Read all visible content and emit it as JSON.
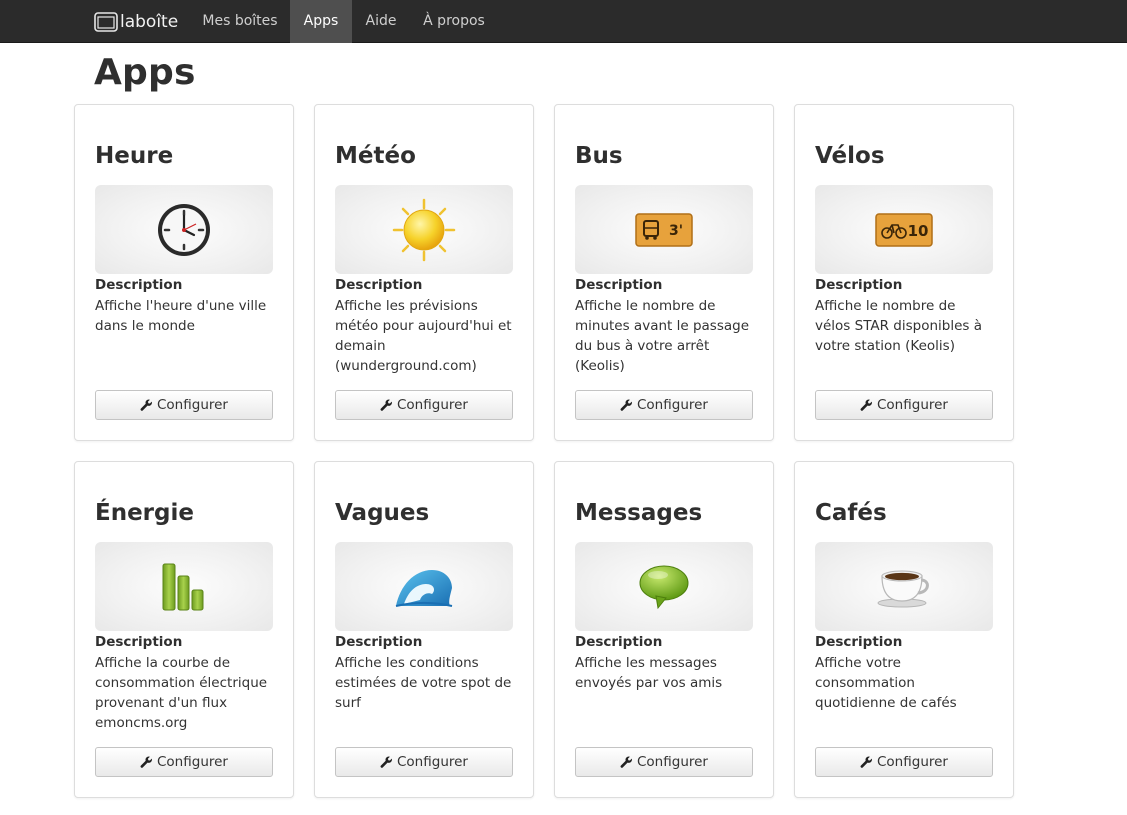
{
  "navbar": {
    "brand": "laboîte",
    "items": [
      {
        "label": "Mes boîtes"
      },
      {
        "label": "Apps"
      },
      {
        "label": "Aide"
      },
      {
        "label": "À propos"
      }
    ]
  },
  "page": {
    "title": "Apps"
  },
  "apps": [
    {
      "title": "Heure",
      "icon": "clock-icon",
      "desc_label": "Description",
      "description": "Affiche l'heure d'une ville dans le monde",
      "button": "Configurer"
    },
    {
      "title": "Météo",
      "icon": "sun-icon",
      "desc_label": "Description",
      "description": "Affiche les prévisions météo pour aujourd'hui et demain (wunderground.com)",
      "button": "Configurer"
    },
    {
      "title": "Bus",
      "icon": "bus-icon",
      "icon_text": "3'",
      "desc_label": "Description",
      "description": "Affiche le nombre de minutes avant le passage du bus à votre arrêt (Keolis)",
      "button": "Configurer"
    },
    {
      "title": "Vélos",
      "icon": "bike-icon",
      "icon_text": "10",
      "desc_label": "Description",
      "description": "Affiche le nombre de vélos STAR disponibles à votre station (Keolis)",
      "button": "Configurer"
    },
    {
      "title": "Énergie",
      "icon": "energy-bars-icon",
      "desc_label": "Description",
      "description": "Affiche la courbe de consommation électrique provenant d'un flux emoncms.org",
      "button": "Configurer"
    },
    {
      "title": "Vagues",
      "icon": "wave-icon",
      "desc_label": "Description",
      "description": "Affiche les conditions estimées de votre spot de surf",
      "button": "Configurer"
    },
    {
      "title": "Messages",
      "icon": "speech-bubble-icon",
      "desc_label": "Description",
      "description": "Affiche les messages envoyés par vos amis",
      "button": "Configurer"
    },
    {
      "title": "Cafés",
      "icon": "coffee-cup-icon",
      "desc_label": "Description",
      "description": "Affiche votre consommation quotidienne de cafés",
      "button": "Configurer"
    }
  ]
}
